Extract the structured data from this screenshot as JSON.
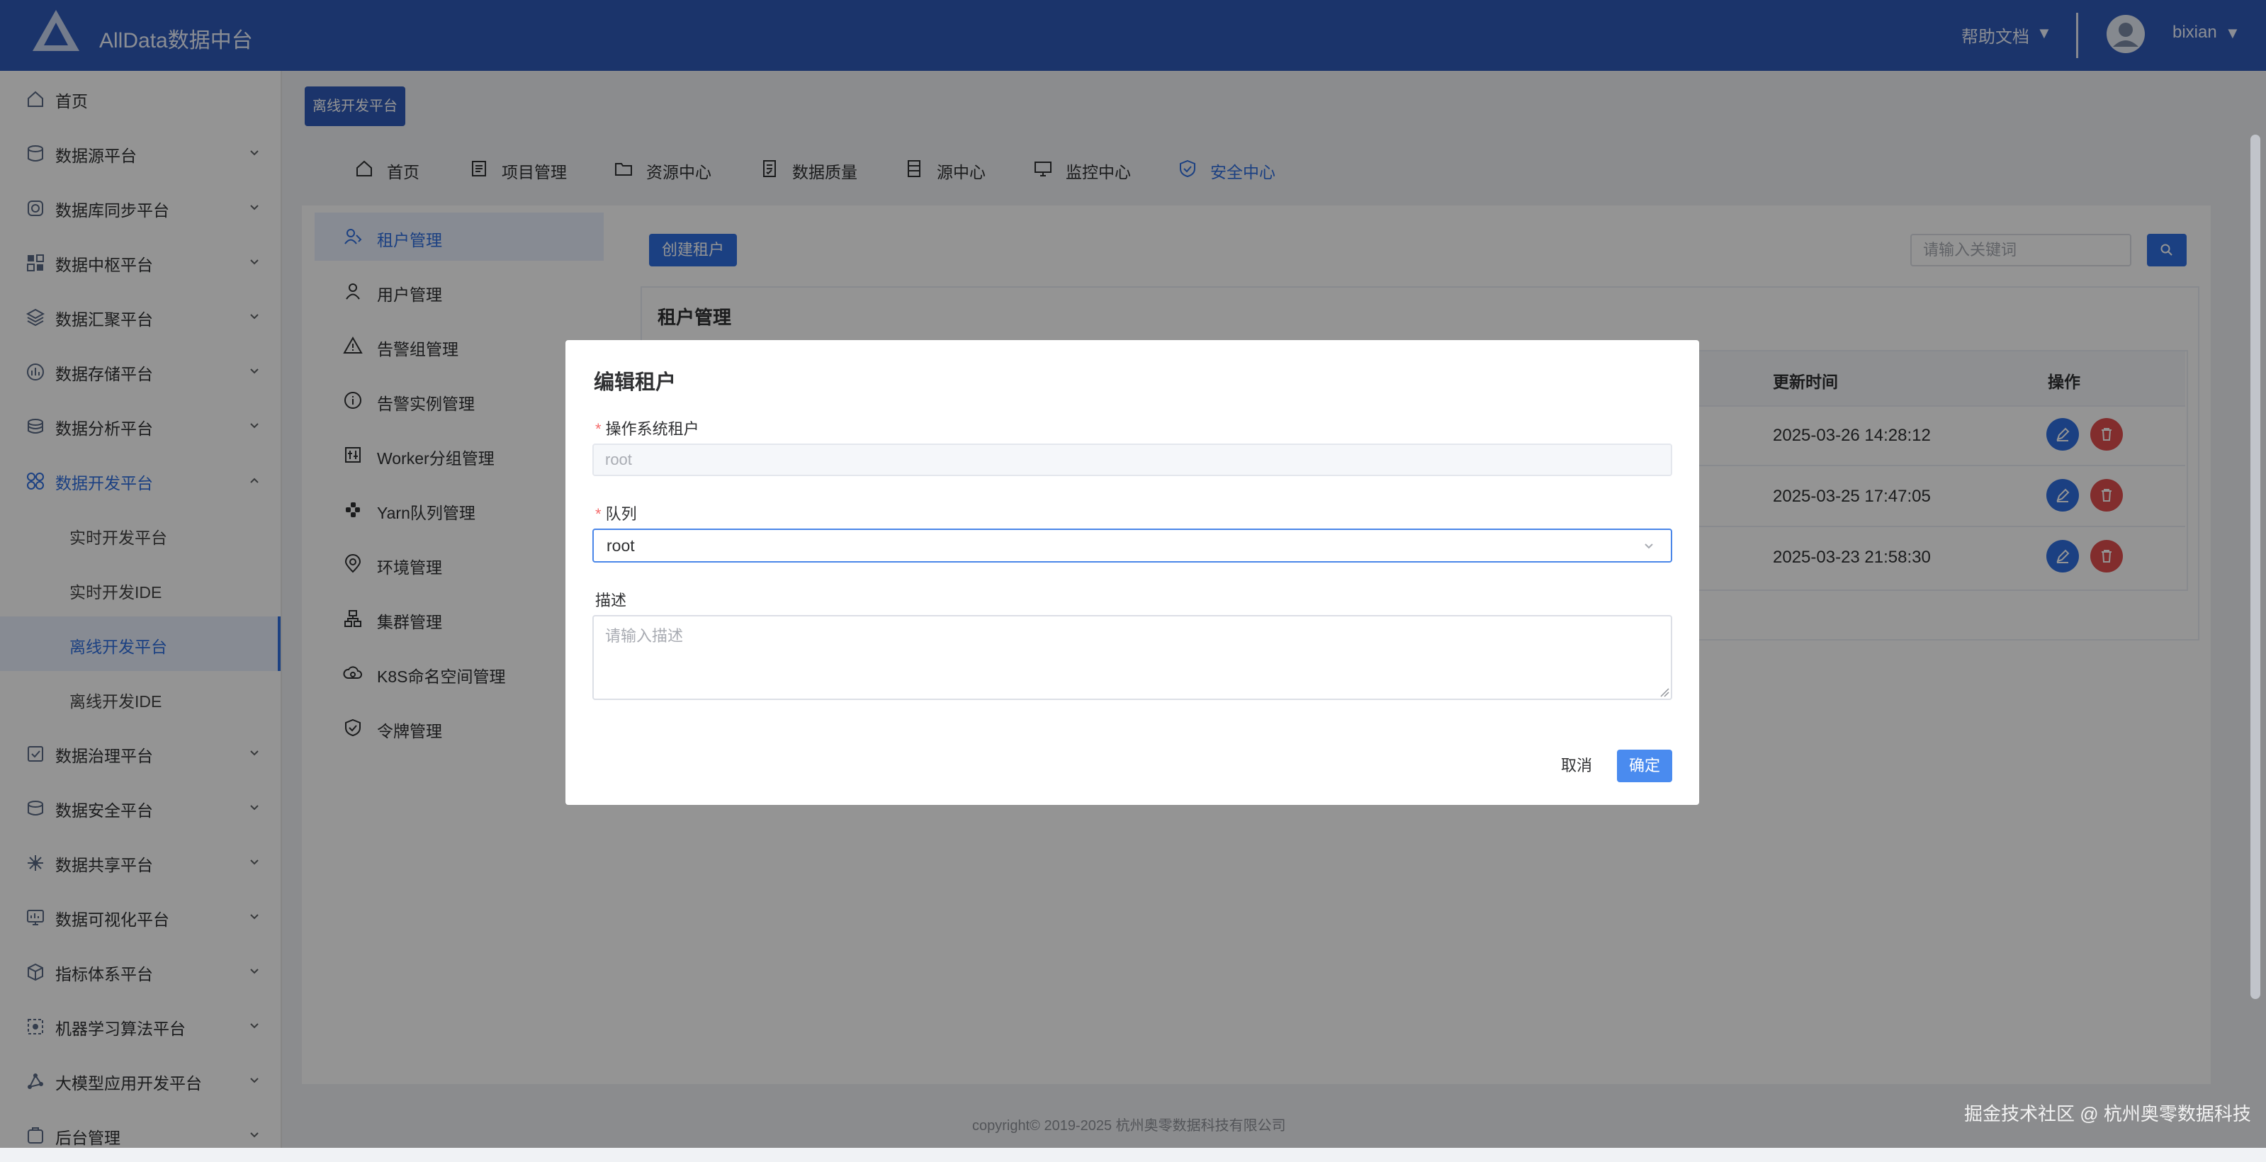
{
  "header": {
    "app_title": "AllData数据中台",
    "help_docs": "帮助文档",
    "caret": "▼",
    "username": "bixian"
  },
  "sidebar": {
    "items": [
      {
        "label": "首页",
        "icon": "home-icon"
      },
      {
        "label": "数据源平台",
        "icon": "database-icon"
      },
      {
        "label": "数据库同步平台",
        "icon": "sync-icon"
      },
      {
        "label": "数据中枢平台",
        "icon": "grid-icon"
      },
      {
        "label": "数据汇聚平台",
        "icon": "layers-icon"
      },
      {
        "label": "数据存储平台",
        "icon": "storage-icon"
      },
      {
        "label": "数据分析平台",
        "icon": "analysis-icon"
      },
      {
        "label": "数据开发平台",
        "icon": "dev-icon"
      },
      {
        "label": "实时开发平台"
      },
      {
        "label": "实时开发IDE"
      },
      {
        "label": "离线开发平台"
      },
      {
        "label": "离线开发IDE"
      },
      {
        "label": "数据治理平台",
        "icon": "governance-icon"
      },
      {
        "label": "数据安全平台",
        "icon": "security-icon"
      },
      {
        "label": "数据共享平台",
        "icon": "share-icon"
      },
      {
        "label": "数据可视化平台",
        "icon": "visualization-icon"
      },
      {
        "label": "指标体系平台",
        "icon": "metrics-icon"
      },
      {
        "label": "机器学习算法平台",
        "icon": "ml-icon"
      },
      {
        "label": "大模型应用开发平台",
        "icon": "llm-icon"
      },
      {
        "label": "后台管理",
        "icon": "admin-icon"
      }
    ]
  },
  "breadcrumb_tag": "离线开发平台",
  "topnav": {
    "items": [
      {
        "label": "首页",
        "icon": "home-icon"
      },
      {
        "label": "项目管理",
        "icon": "project-icon"
      },
      {
        "label": "资源中心",
        "icon": "folder-icon"
      },
      {
        "label": "数据质量",
        "icon": "quality-icon"
      },
      {
        "label": "源中心",
        "icon": "source-icon"
      },
      {
        "label": "监控中心",
        "icon": "monitor-icon"
      },
      {
        "label": "安全中心",
        "icon": "shield-icon"
      }
    ],
    "active": "安全中心"
  },
  "security_menu": {
    "items": [
      {
        "label": "租户管理",
        "icon": "tenant-icon"
      },
      {
        "label": "用户管理",
        "icon": "user-icon"
      },
      {
        "label": "告警组管理",
        "icon": "warning-icon"
      },
      {
        "label": "告警实例管理",
        "icon": "info-icon"
      },
      {
        "label": "Worker分组管理",
        "icon": "worker-icon"
      },
      {
        "label": "Yarn队列管理",
        "icon": "yarn-icon"
      },
      {
        "label": "环境管理",
        "icon": "location-icon"
      },
      {
        "label": "集群管理",
        "icon": "cluster-icon"
      },
      {
        "label": "K8S命名空间管理",
        "icon": "cloud-icon"
      },
      {
        "label": "令牌管理",
        "icon": "token-icon"
      }
    ],
    "active": "租户管理"
  },
  "toolbar": {
    "create_label": "创建租户",
    "search_placeholder": "请输入关键词"
  },
  "table": {
    "card_title": "租户管理",
    "columns": [
      "更新时间",
      "操作"
    ],
    "rows": [
      {
        "updated": "2025-03-26 14:28:12"
      },
      {
        "updated": "2025-03-25 17:47:05"
      },
      {
        "updated": "2025-03-23 21:58:30"
      }
    ]
  },
  "dialog": {
    "title": "编辑租户",
    "required_mark": "*",
    "os_tenant_label": "操作系统租户",
    "os_tenant_value": "root",
    "queue_label": "队列",
    "queue_value": "root",
    "description_label": "描述",
    "description_placeholder": "请输入描述",
    "cancel_label": "取消",
    "confirm_label": "确定"
  },
  "footer": {
    "copyright": "copyright© 2019-2025 杭州奥零数据科技有限公司"
  },
  "watermark": "掘金技术社区 @ 杭州奥零数据科技",
  "colors": {
    "header_bg": "#2f5bb8",
    "primary": "#2f6fe0",
    "danger": "#e04f4f",
    "required": "#f56c6c"
  }
}
